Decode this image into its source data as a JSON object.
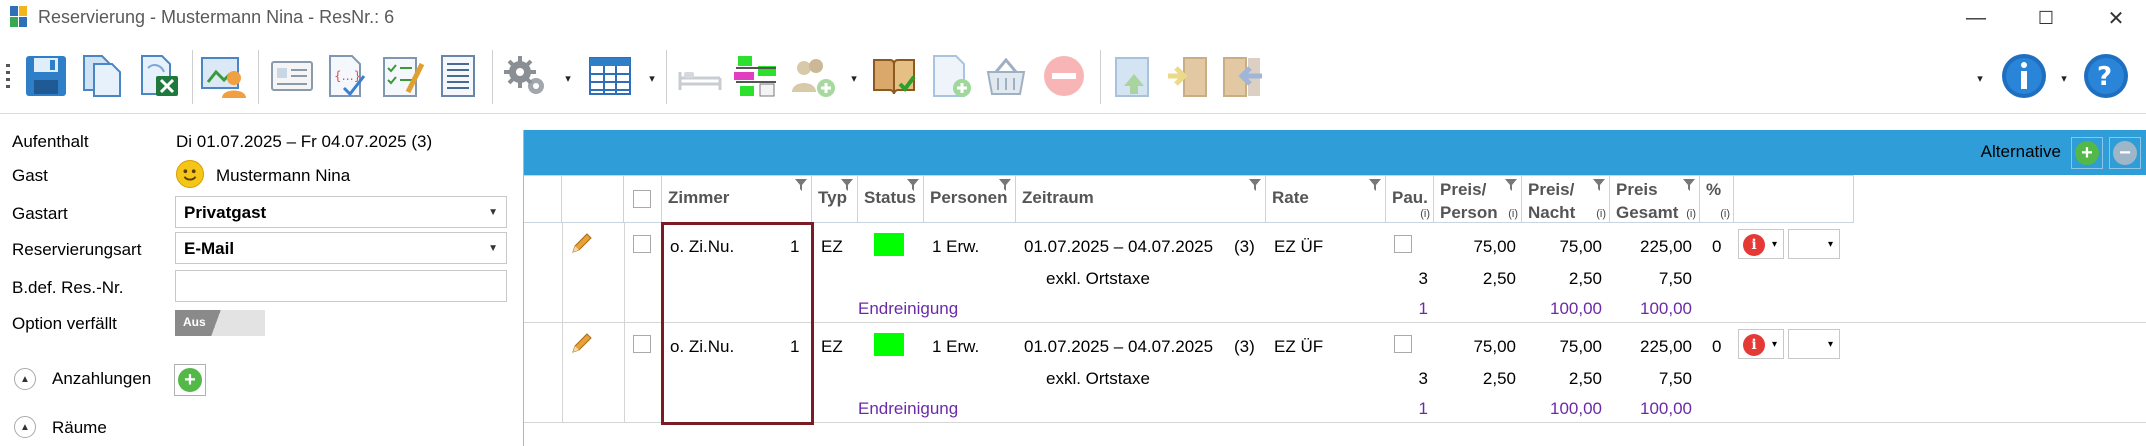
{
  "window": {
    "title": "Reservierung - Mustermann Nina - ResNr.: 6",
    "minimize": "—",
    "maximize": "☐",
    "close": "✕"
  },
  "toolbar": {
    "buttons": [
      "save-icon",
      "copy-icon",
      "excel-export-icon",
      "guest-card-icon",
      "registration-form-icon",
      "document-edit-icon",
      "checklist-icon",
      "list-doc-icon",
      "settings-icon",
      "table-view-icon",
      "bed-icon",
      "room-plan-icon",
      "add-person-icon",
      "book-check-icon",
      "new-document-icon",
      "basket-icon",
      "remove-icon",
      "checkin-icon",
      "move-icon",
      "checkout-icon",
      "info-icon",
      "help-icon"
    ],
    "dropdown_arrow": "▾"
  },
  "form": {
    "aufenthalt_label": "Aufenthalt",
    "aufenthalt_value": "Di 01.07.2025 – Fr 04.07.2025 (3)",
    "gast_label": "Gast",
    "gast_value": "Mustermann Nina",
    "gastart_label": "Gastart",
    "gastart_value": "Privatgast",
    "resart_label": "Reservierungsart",
    "resart_value": "E-Mail",
    "bdef_label": "B.def. Res.-Nr.",
    "bdef_value": "",
    "option_label": "Option verfällt",
    "option_toggle": "Aus",
    "anzahlungen_label": "Anzahlungen",
    "raeume_label": "Räume",
    "combo_arrow": "▼",
    "expand_arrow": "▲",
    "add_symbol": "+"
  },
  "main": {
    "alternative_label": "Alternative",
    "add_symbol": "+",
    "remove_symbol": "−"
  },
  "columns": {
    "zimmer": "Zimmer",
    "typ": "Typ",
    "status": "Status",
    "personen": "Personen",
    "zeitraum": "Zeitraum",
    "rate": "Rate",
    "pau": "Pau.",
    "preis_person_1": "Preis/",
    "preis_person_2": "Person",
    "preis_nacht_1": "Preis/",
    "preis_nacht_2": "Nacht",
    "preis_gesamt_1": "Preis",
    "preis_gesamt_2": "Gesamt",
    "prozent_1": "%",
    "info_mark": "(i)"
  },
  "rows": [
    {
      "zimmer": "o. Zi.Nu.",
      "zimmer_count": "1",
      "typ": "EZ",
      "personen": "1 Erw.",
      "zeitraum": "01.07.2025 – 04.07.2025",
      "naechte": "(3)",
      "rate": "EZ ÜF",
      "preis_person": "75,00",
      "preis_nacht": "75,00",
      "preis_gesamt": "225,00",
      "prozent": "0",
      "extra_label": "exkl. Ortstaxe",
      "extra_qty": "3",
      "extra_person": "2,50",
      "extra_nacht": "2,50",
      "extra_gesamt": "7,50",
      "service_label": "Endreinigung",
      "service_qty": "1",
      "service_nacht": "100,00",
      "service_gesamt": "100,00",
      "info_symbol": "i",
      "dd_arrow": "▾"
    },
    {
      "zimmer": "o. Zi.Nu.",
      "zimmer_count": "1",
      "typ": "EZ",
      "personen": "1 Erw.",
      "zeitraum": "01.07.2025 – 04.07.2025",
      "naechte": "(3)",
      "rate": "EZ ÜF",
      "preis_person": "75,00",
      "preis_nacht": "75,00",
      "preis_gesamt": "225,00",
      "prozent": "0",
      "extra_label": "exkl. Ortstaxe",
      "extra_qty": "3",
      "extra_person": "2,50",
      "extra_nacht": "2,50",
      "extra_gesamt": "7,50",
      "service_label": "Endreinigung",
      "service_qty": "1",
      "service_nacht": "100,00",
      "service_gesamt": "100,00",
      "info_symbol": "i",
      "dd_arrow": "▾"
    }
  ],
  "colors": {
    "header_blue": "#2e9dd8",
    "status_green": "#00ff00",
    "service_purple": "#6b2aa8",
    "highlight_border": "#7a1c26"
  }
}
